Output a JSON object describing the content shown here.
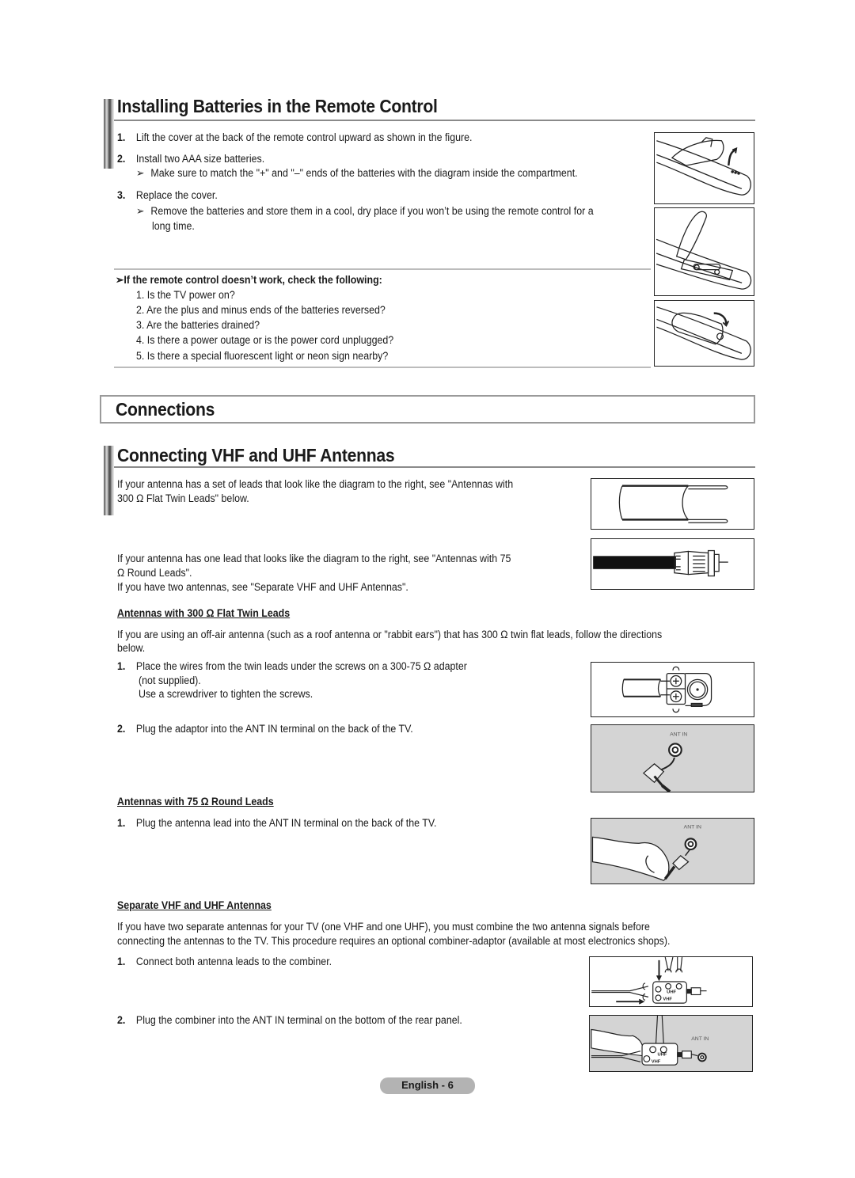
{
  "section_batteries": {
    "title": "Installing Batteries in the Remote Control",
    "steps": [
      {
        "num": "1.",
        "text": "Lift the cover at the back of the remote control upward as shown in the figure."
      },
      {
        "num": "2.",
        "text": "Install two AAA size batteries.",
        "note": "Make sure to match the \"+\" and \"–\" ends of the batteries with the diagram inside the compartment."
      },
      {
        "num": "3.",
        "text": "Replace the cover.",
        "note_line1": "Remove the batteries and store them in a cool, dry place if you won’t be using the remote control for a",
        "note_line2": "long time."
      }
    ],
    "troubleshoot": {
      "heading": "If the remote control doesn’t work, check the following:",
      "items": [
        "1. Is the TV power on?",
        "2. Are the plus and minus ends of the batteries reversed?",
        "3. Are the batteries drained?",
        "4. Is there a power outage or is the power cord unplugged?",
        "5. Is there a special fluorescent light or neon sign nearby?"
      ]
    },
    "note_arrow": "➢"
  },
  "section_connections": {
    "title": "Connections"
  },
  "section_antennas": {
    "title": "Connecting VHF and UHF Antennas",
    "intro1_line1": "If your antenna has a set of leads that look like the diagram to the right, see \"Antennas with",
    "intro1_line2": "300 Ω Flat Twin Leads\" below.",
    "intro2_line1": "If your antenna has one lead that looks like the diagram to the right, see \"Antennas with 75",
    "intro2_line2": "Ω Round Leads\".",
    "intro3": "If you have two antennas, see \"Separate VHF and UHF Antennas\".",
    "flat_twin": {
      "heading": "Antennas with 300 Ω Flat Twin Leads",
      "desc_line1": "If you are using an off-air antenna (such as a roof antenna or \"rabbit ears\") that has 300 Ω twin flat leads, follow the directions",
      "desc_line2": "below.",
      "step1_num": "1.",
      "step1_line1": "Place the wires from the twin leads under the screws on a 300-75 Ω adapter",
      "step1_line2": "(not supplied).",
      "step1_line3": "Use a screwdriver to tighten the screws.",
      "step2_num": "2.",
      "step2": "Plug the adaptor into the ANT IN terminal on the back of the TV."
    },
    "round": {
      "heading": "Antennas with 75 Ω Round Leads",
      "step1_num": "1.",
      "step1": "Plug the antenna lead into the ANT IN terminal on the back of the TV."
    },
    "separate": {
      "heading": "Separate VHF and UHF Antennas",
      "desc_line1": "If you have two separate antennas for your TV (one VHF and one UHF), you must combine the two antenna signals before",
      "desc_line2": "connecting the antennas to the TV. This procedure requires an optional combiner-adaptor (available at most electronics shops).",
      "step1_num": "1.",
      "step1": "Connect both antenna leads to the combiner.",
      "step2_num": "2.",
      "step2": "Plug the combiner into the ANT IN terminal on the bottom of the rear panel."
    },
    "figure_labels": {
      "ant_in": "ANT IN",
      "uhf": "UHF",
      "vhf": "VHF"
    }
  },
  "footer": {
    "page_label": "English - 6"
  }
}
